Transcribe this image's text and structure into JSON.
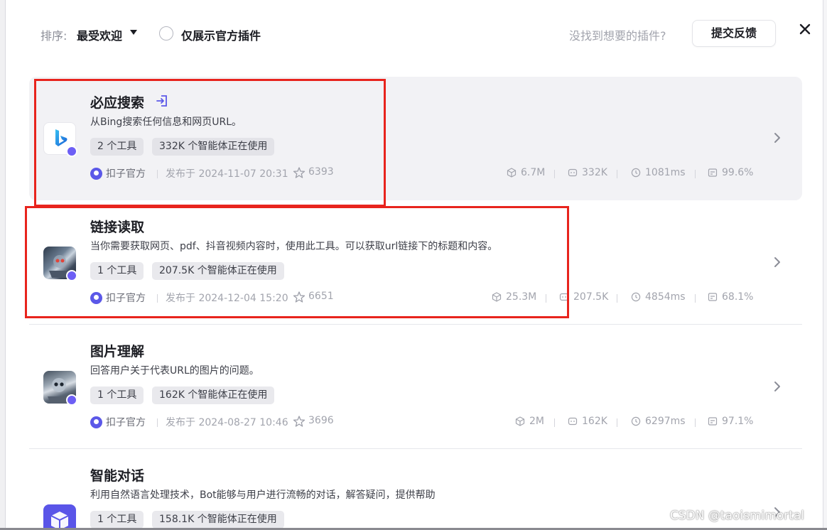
{
  "toolbar": {
    "sort_label": "排序:",
    "sort_value": "最受欢迎",
    "official_only_label": "仅展示官方插件",
    "not_found_text": "没找到想要的插件?",
    "feedback_label": "提交反馈",
    "close_icon": "close-icon"
  },
  "plugins": [
    {
      "title": "必应搜索",
      "desc": "从Bing搜索任何信息和网页URL。",
      "tags": [
        "2 个工具",
        "332K 个智能体正在使用"
      ],
      "author": "扣子官方",
      "published": "发布于 2024-11-07 20:31",
      "stars": "6393",
      "metrics": [
        "6.7M",
        "332K",
        "1081ms",
        "99.6%"
      ],
      "icon": "bing-icon"
    },
    {
      "title": "链接读取",
      "desc": "当你需要获取网页、pdf、抖音视频内容时，使用此工具。可以获取url链接下的标题和内容。",
      "tags": [
        "1 个工具",
        "207.5K 个智能体正在使用"
      ],
      "author": "扣子官方",
      "published": "发布于 2024-12-04 15:20",
      "stars": "6651",
      "metrics": [
        "25.3M",
        "207.5K",
        "4854ms",
        "68.1%"
      ],
      "icon": "robot-image-icon"
    },
    {
      "title": "图片理解",
      "desc": "回答用户关于代表URL的图片的问题。",
      "tags": [
        "1 个工具",
        "162K 个智能体正在使用"
      ],
      "author": "扣子官方",
      "published": "发布于 2024-08-27 10:46",
      "stars": "3696",
      "metrics": [
        "2M",
        "162K",
        "6297ms",
        "97.1%"
      ],
      "icon": "robot-image-icon"
    },
    {
      "title": "智能对话",
      "desc": "利用自然语言处理技术，Bot能够与用户进行流畅的对话，解答疑问，提供帮助",
      "tags": [
        "1 个工具",
        "158.1K 个智能体正在使用"
      ],
      "icon": "cube-icon"
    }
  ],
  "colors": {
    "accent": "#5b58e8",
    "annotation_red": "#e8241d",
    "hover_bg": "#f2f2f5"
  },
  "watermark": "CSDN @taoismimortal"
}
